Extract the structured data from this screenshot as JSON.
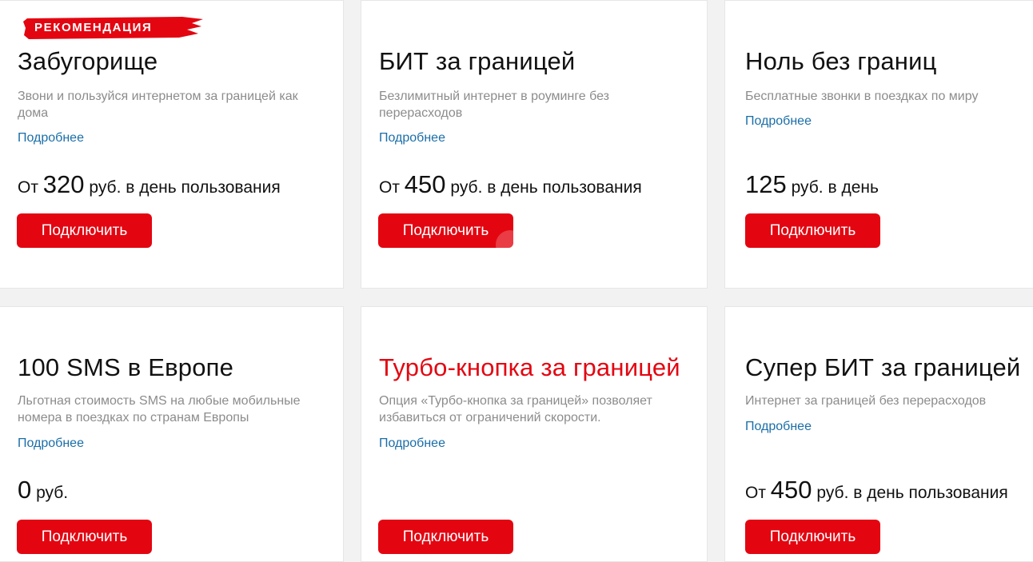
{
  "cards": [
    {
      "badge": "РЕКОМЕНДАЦИЯ",
      "title": "Забугорище",
      "description": "Звони и пользуйся интернетом за границей как дома",
      "more": "Подробнее",
      "price_prefix": "От",
      "price_value": "320",
      "price_suffix": "руб. в день пользования",
      "button": "Подключить"
    },
    {
      "title": "БИТ за границей",
      "description": "Безлимитный интернет в роуминге без перерасходов",
      "more": "Подробнее",
      "price_prefix": "От",
      "price_value": "450",
      "price_suffix": "руб. в день пользования",
      "button": "Подключить"
    },
    {
      "title": "Ноль без границ",
      "description": "Бесплатные звонки в поездках по миру",
      "more": "Подробнее",
      "price_prefix": "",
      "price_value": "125",
      "price_suffix": "руб. в день",
      "button": "Подключить"
    },
    {
      "title": "100 SMS в Европе",
      "description": "Льготная стоимость SMS на любые мобильные номера в поездках по странам Европы",
      "more": "Подробнее",
      "price_prefix": "",
      "price_value": "0",
      "price_suffix": "руб.",
      "button": "Подключить"
    },
    {
      "title": "Турбо-кнопка за границей",
      "description": "Опция «Турбо-кнопка за границей» позволяет избавиться от ограничений скорости.",
      "more": "Подробнее",
      "button": "Подключить"
    },
    {
      "title": "Супер БИТ за границей",
      "description": "Интернет за границей без перерасходов",
      "more": "Подробнее",
      "price_prefix": "От",
      "price_value": "450",
      "price_suffix": "руб. в день пользования",
      "button": "Подключить"
    }
  ],
  "colors": {
    "accent": "#e30611",
    "link": "#1a6ea8",
    "muted_text": "#8c8c8c"
  }
}
